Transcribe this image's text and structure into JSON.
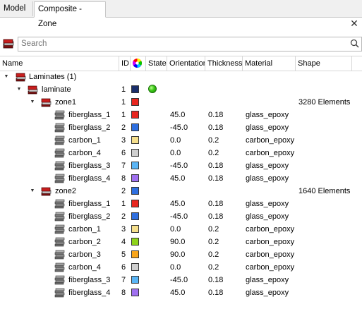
{
  "tabs": [
    {
      "label": "Model",
      "active": false
    },
    {
      "label": "Composite - Zone",
      "active": true
    }
  ],
  "close_glyph": "✕",
  "search": {
    "placeholder": "Search",
    "value": ""
  },
  "columns": [
    "Name",
    "ID",
    "",
    "State",
    "Orientation",
    "Thickness",
    "Material",
    "Shape"
  ],
  "colors": {
    "fiberglass_1": "#e8261f",
    "fiberglass_2": "#2e6fe0",
    "carbon_1": "#f5df8c",
    "carbon_2": "#8ed31b",
    "carbon_3": "#f9a51a",
    "carbon_4": "#cfcfcf",
    "fiberglass_3": "#5ab5f5",
    "fiberglass_4": "#a070f0",
    "laminate": "#1a2e6b",
    "zone1": "#e8261f",
    "zone2": "#2e6fe0",
    "state_active": "#39c615"
  },
  "tree": {
    "root": {
      "label": "Laminates (1)",
      "icon": "laminates-folder-icon"
    },
    "laminate": {
      "label": "laminate",
      "id": "1",
      "color": "#1a2e6b",
      "state": "active",
      "icon": "laminate-icon"
    },
    "zones": [
      {
        "label": "zone1",
        "id": "1",
        "color": "#e8261f",
        "shape": "3280 Elements",
        "icon": "zone-icon",
        "plies": [
          {
            "label": "fiberglass_1",
            "id": "1",
            "color": "#e8261f",
            "orientation": "45.0",
            "thickness": "0.18",
            "material": "glass_epoxy"
          },
          {
            "label": "fiberglass_2",
            "id": "2",
            "color": "#2e6fe0",
            "orientation": "-45.0",
            "thickness": "0.18",
            "material": "glass_epoxy"
          },
          {
            "label": "carbon_1",
            "id": "3",
            "color": "#f5df8c",
            "orientation": "0.0",
            "thickness": "0.2",
            "material": "carbon_epoxy"
          },
          {
            "label": "carbon_4",
            "id": "6",
            "color": "#cfcfcf",
            "orientation": "0.0",
            "thickness": "0.2",
            "material": "carbon_epoxy"
          },
          {
            "label": "fiberglass_3",
            "id": "7",
            "color": "#5ab5f5",
            "orientation": "-45.0",
            "thickness": "0.18",
            "material": "glass_epoxy"
          },
          {
            "label": "fiberglass_4",
            "id": "8",
            "color": "#a070f0",
            "orientation": "45.0",
            "thickness": "0.18",
            "material": "glass_epoxy"
          }
        ]
      },
      {
        "label": "zone2",
        "id": "2",
        "color": "#2e6fe0",
        "shape": "1640 Elements",
        "icon": "zone-icon",
        "plies": [
          {
            "label": "fiberglass_1",
            "id": "1",
            "color": "#e8261f",
            "orientation": "45.0",
            "thickness": "0.18",
            "material": "glass_epoxy"
          },
          {
            "label": "fiberglass_2",
            "id": "2",
            "color": "#2e6fe0",
            "orientation": "-45.0",
            "thickness": "0.18",
            "material": "glass_epoxy"
          },
          {
            "label": "carbon_1",
            "id": "3",
            "color": "#f5df8c",
            "orientation": "0.0",
            "thickness": "0.2",
            "material": "carbon_epoxy"
          },
          {
            "label": "carbon_2",
            "id": "4",
            "color": "#8ed31b",
            "orientation": "90.0",
            "thickness": "0.2",
            "material": "carbon_epoxy"
          },
          {
            "label": "carbon_3",
            "id": "5",
            "color": "#f9a51a",
            "orientation": "90.0",
            "thickness": "0.2",
            "material": "carbon_epoxy"
          },
          {
            "label": "carbon_4",
            "id": "6",
            "color": "#cfcfcf",
            "orientation": "0.0",
            "thickness": "0.2",
            "material": "carbon_epoxy"
          },
          {
            "label": "fiberglass_3",
            "id": "7",
            "color": "#5ab5f5",
            "orientation": "-45.0",
            "thickness": "0.18",
            "material": "glass_epoxy"
          },
          {
            "label": "fiberglass_4",
            "id": "8",
            "color": "#a070f0",
            "orientation": "45.0",
            "thickness": "0.18",
            "material": "glass_epoxy"
          }
        ]
      }
    ]
  }
}
